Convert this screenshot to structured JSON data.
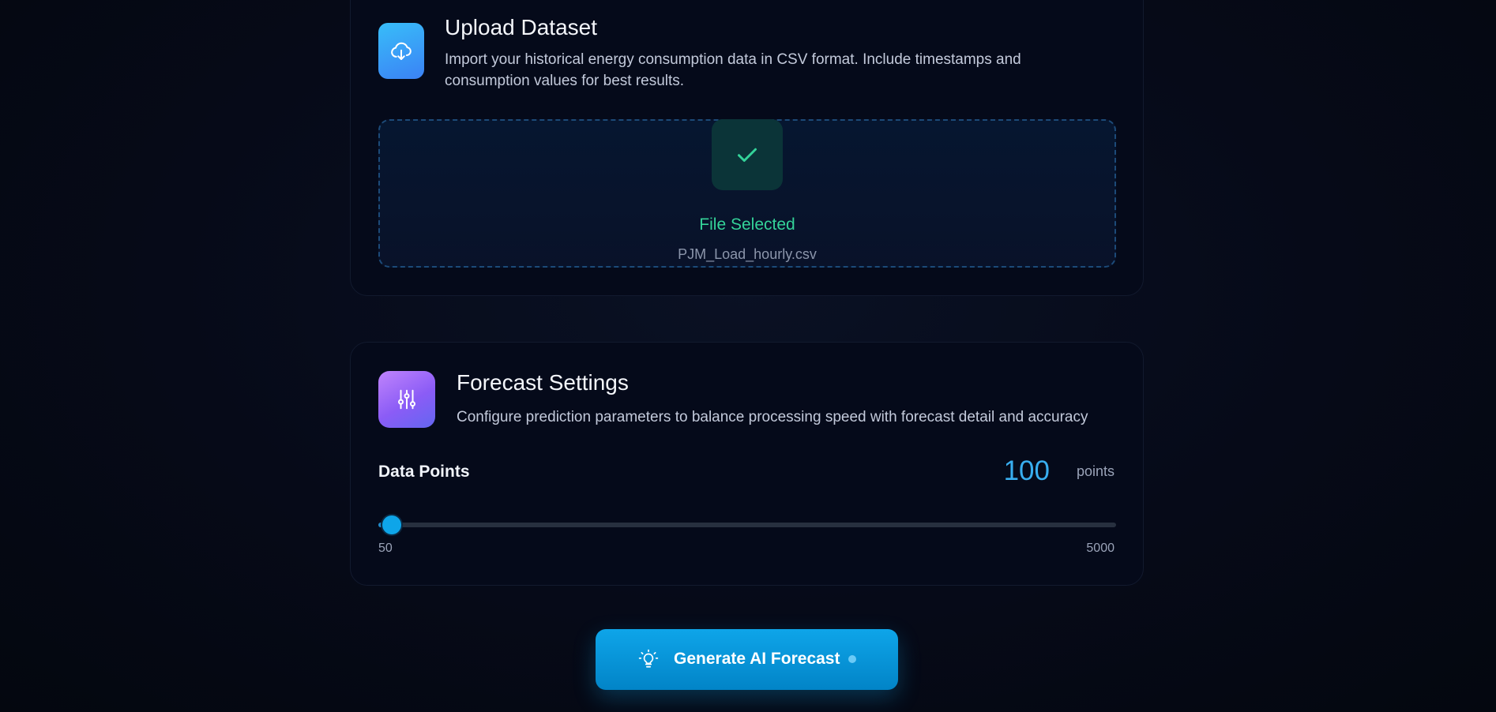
{
  "upload": {
    "title": "Upload Dataset",
    "description": "Import your historical energy consumption data in CSV format. Include timestamps and consumption values for best results.",
    "icon": "cloud-download-icon",
    "status": "File Selected",
    "file_name": "PJM_Load_hourly.csv"
  },
  "settings": {
    "title": "Forecast Settings",
    "description": "Configure prediction parameters to balance processing speed with forecast detail and accuracy",
    "icon": "sliders-icon",
    "data_points": {
      "label": "Data Points",
      "value": "100",
      "unit": "points",
      "min": "50",
      "max": "5000",
      "current": 100
    }
  },
  "actions": {
    "generate_label": "Generate AI Forecast",
    "generate_icon": "lightbulb-icon"
  },
  "colors": {
    "accent": "#0ea5e9",
    "success": "#34d399",
    "upload_icon_bg": "#3b82f6",
    "settings_icon_bg": "#8b5cf6"
  }
}
